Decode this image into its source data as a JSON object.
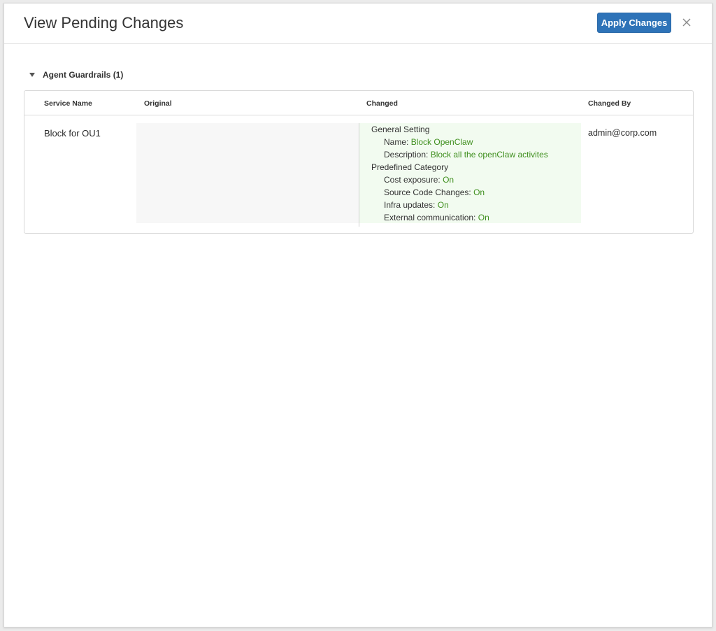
{
  "dialog": {
    "title": "View Pending Changes",
    "apply_label": "Apply Changes",
    "close_icon": "close-icon"
  },
  "section": {
    "label": "Agent Guardrails (1)",
    "expanded": true
  },
  "table": {
    "columns": [
      "Service Name",
      "Original",
      "Changed",
      "Changed By"
    ],
    "rows": [
      {
        "service_name": "Block for OU1",
        "original": "",
        "changed": {
          "general_setting": {
            "heading": "General Setting",
            "name_label": "Name:",
            "name_value": "Block OpenClaw",
            "description_label": "Description:",
            "description_value": "Block all the openClaw activites"
          },
          "predefined_category": {
            "heading": "Predefined Category",
            "items": [
              {
                "label": "Cost exposure:",
                "value": "On"
              },
              {
                "label": "Source Code Changes:",
                "value": "On"
              },
              {
                "label": "Infra updates:",
                "value": "On"
              },
              {
                "label": "External communication:",
                "value": "On"
              }
            ]
          }
        },
        "changed_by": "admin@corp.com"
      }
    ]
  },
  "colors": {
    "primary_button": "#2e73b8",
    "changed_value": "#3f8f1e",
    "changed_bg": "#f2fbf0",
    "original_bg": "#f7f7f7"
  }
}
